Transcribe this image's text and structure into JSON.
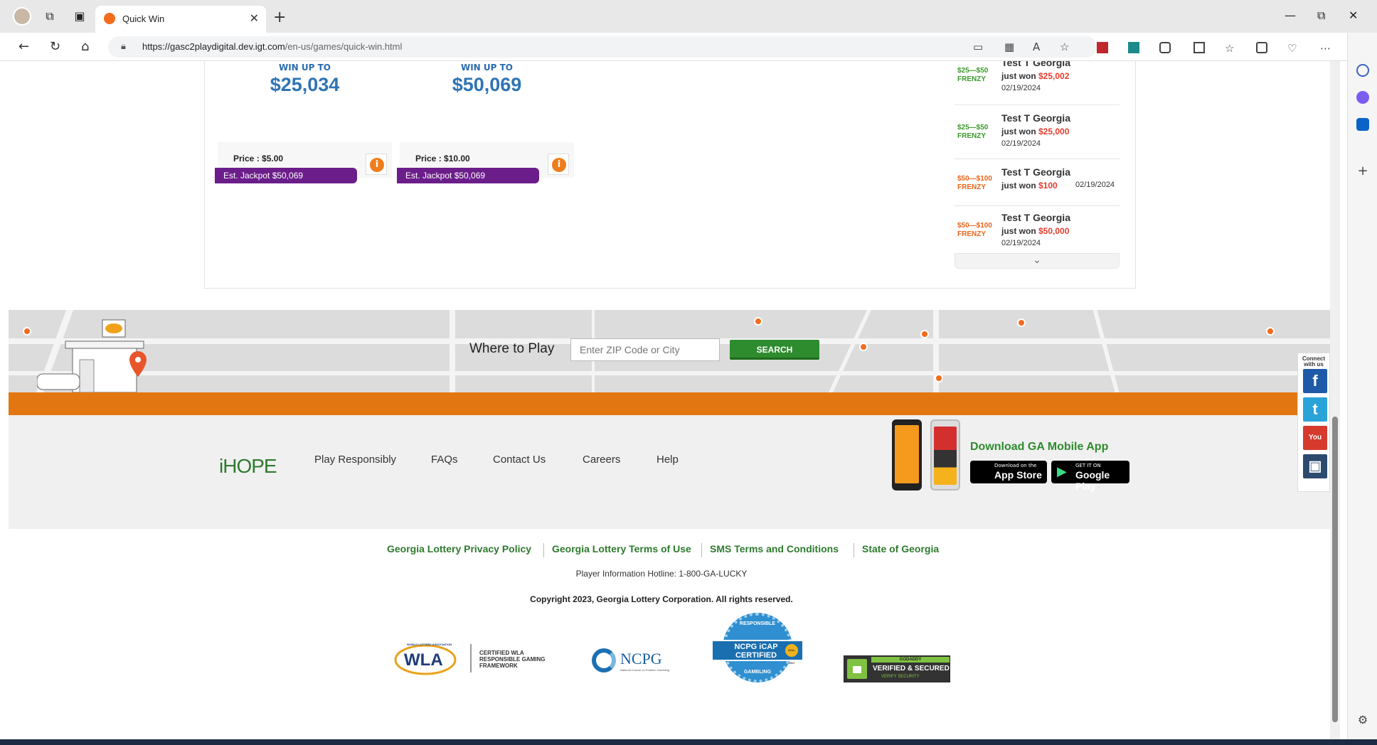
{
  "browser": {
    "tab_title": "Quick Win",
    "url_host": "https://gasc2playdigital.dev.igt.com",
    "url_path": "/en-us/games/quick-win.html"
  },
  "games": [
    {
      "win_label": "WIN UP TO",
      "win_amount": "$25,034",
      "price": "Price : $5.00",
      "jackpot": "Est. Jackpot $50,069"
    },
    {
      "win_label": "WIN UP TO",
      "win_amount": "$50,069",
      "price": "Price : $10.00",
      "jackpot": "Est. Jackpot $50,069"
    }
  ],
  "winners": [
    {
      "logo": "$25—$50 FRENZY",
      "logo_color": "#3a9a2a",
      "name": "Test T Georgia",
      "won_prefix": "just won ",
      "amount": "$25,002",
      "date": "02/19/2024"
    },
    {
      "logo": "$25—$50 FRENZY",
      "logo_color": "#3a9a2a",
      "name": "Test T Georgia",
      "won_prefix": "just won ",
      "amount": "$25,000",
      "date": "02/19/2024"
    },
    {
      "logo": "$50—$100 FRENZY",
      "logo_color": "#e8651c",
      "name": "Test T Georgia",
      "won_prefix": "just won ",
      "amount": "$100",
      "date": "02/19/2024"
    },
    {
      "logo": "$50—$100 FRENZY",
      "logo_color": "#e8651c",
      "name": "Test T Georgia",
      "won_prefix": "just won ",
      "amount": "$50,000",
      "date": "02/19/2024"
    }
  ],
  "where_to_play": {
    "label": "Where to Play",
    "placeholder": "Enter ZIP Code or City",
    "search_label": "SEARCH"
  },
  "footer": {
    "logo_text": "iHOPE",
    "links": [
      "Play Responsibly",
      "FAQs",
      "Contact Us",
      "Careers",
      "Help"
    ],
    "app_title": "Download GA Mobile App",
    "app_store_small": "Download on the",
    "app_store_big": "App Store",
    "google_small": "GET IT ON",
    "google_big": "Google Play"
  },
  "social": {
    "label": "Connect with us",
    "items": [
      {
        "name": "facebook",
        "glyph": "f",
        "color": "#1f5aa8"
      },
      {
        "name": "twitter",
        "glyph": "t",
        "color": "#2aa3d9"
      },
      {
        "name": "youtube",
        "glyph": "You",
        "color": "#d63a2c"
      },
      {
        "name": "instagram",
        "glyph": "▣",
        "color": "#2c4a6e"
      }
    ]
  },
  "legal": {
    "links": [
      "Georgia Lottery Privacy Policy",
      "Georgia Lottery Terms of Use",
      "SMS Terms and Conditions",
      "State of Georgia"
    ],
    "hotline": "Player Information Hotline: 1-800-GA-LUCKY",
    "copyright": "Copyright 2023, Georgia Lottery Corporation. All rights reserved."
  },
  "badges": {
    "wla_logo": "WLA",
    "wla_assoc": "WORLD LOTTERY ASSOCIATION",
    "wla_text": "CERTIFIED WLA RESPONSIBLE GAMING FRAMEWORK",
    "ncpg": "NCPG",
    "ncpg_sub": "National Council on Problem Gambling",
    "icap_top": "RESPONSIBLE",
    "icap": "NCPG iCAP CERTIFIED",
    "icap_bottom": "GAMBLING",
    "icap_years": "2016-2017",
    "godaddy_top": "GODADDY",
    "godaddy": "VERIFIED & SECURED",
    "godaddy_sub": "VERIFY SECURITY"
  },
  "colors": {
    "accent_green": "#2e8b2e",
    "brand_orange": "#e27711",
    "jackpot_purple": "#6b1d8a",
    "win_blue": "#2e74b5"
  }
}
